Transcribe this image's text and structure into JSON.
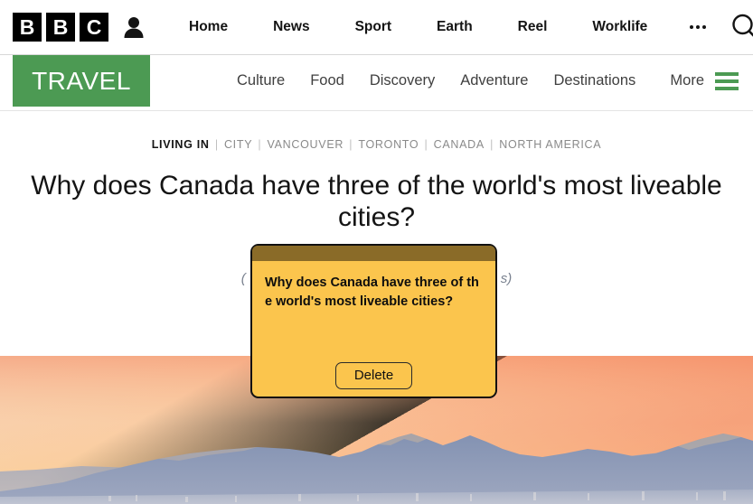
{
  "global_nav": {
    "logo_letters": [
      "B",
      "B",
      "C"
    ],
    "account_icon": "account-person-icon",
    "links": [
      {
        "label": "Home"
      },
      {
        "label": "News"
      },
      {
        "label": "Sport"
      },
      {
        "label": "Earth"
      },
      {
        "label": "Reel"
      },
      {
        "label": "Worklife"
      }
    ],
    "more_icon": "ellipsis-icon",
    "search_icon": "search-icon"
  },
  "brand_bar": {
    "logo_label": "TRAVEL",
    "logo_color": "#4c9a53",
    "links": [
      {
        "label": "Culture"
      },
      {
        "label": "Food"
      },
      {
        "label": "Discovery"
      },
      {
        "label": "Adventure"
      },
      {
        "label": "Destinations"
      }
    ],
    "more_label": "More",
    "menu_icon": "hamburger-menu-icon"
  },
  "article": {
    "breadcrumb": {
      "primary": "LIVING IN",
      "separator": "|",
      "items": [
        "CITY",
        "VANCOUVER",
        "TORONTO",
        "CANADA",
        "NORTH AMERICA"
      ]
    },
    "headline": "Why does Canada have three of the world's most liveable cities?",
    "image_credit_left": "(",
    "image_credit_right": "s)"
  },
  "hero_image": {
    "description": "sunset-mountain-skyline-photo",
    "sky_left": "#f6d9b6",
    "sky_mid": "#fbd1a0",
    "sky_right": "#f79b6e",
    "mountain_color": "#7f8fae",
    "foreground_color": "#9aa3bb"
  },
  "note_dialog": {
    "title_bar_color": "#8a6b28",
    "body_color": "#fbc54d",
    "text": "Why does Canada have three of the world's most liveable cities?",
    "delete_label": "Delete"
  }
}
